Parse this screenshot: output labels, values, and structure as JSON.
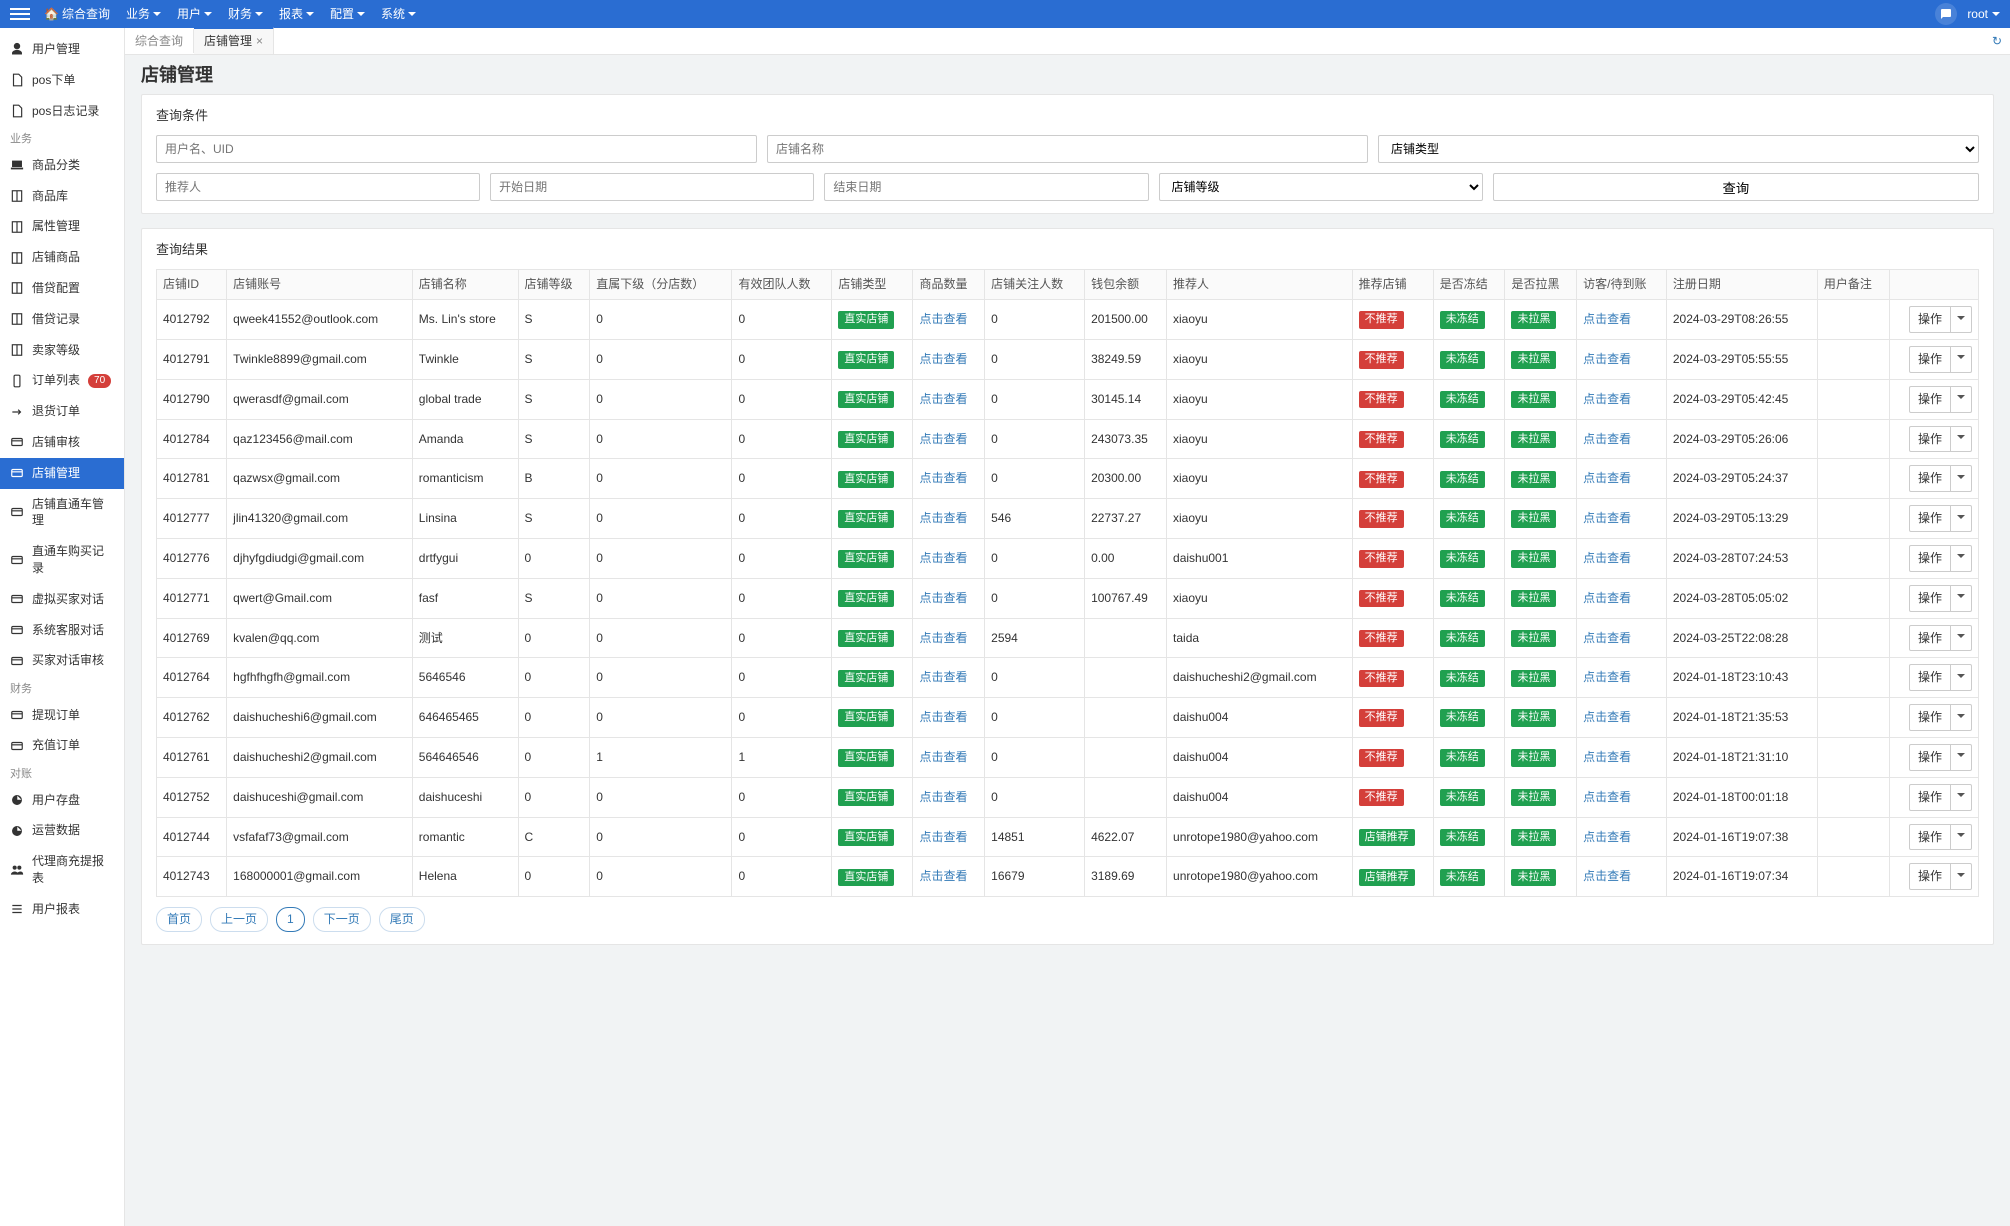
{
  "topnav": {
    "home": "综合查询",
    "items": [
      "业务",
      "用户",
      "财务",
      "报表",
      "配置",
      "系统"
    ],
    "user": "root"
  },
  "sidebar": {
    "sections": [
      {
        "group": null,
        "items": [
          {
            "icon": "user",
            "label": "用户管理"
          },
          {
            "icon": "doc",
            "label": "pos下单"
          },
          {
            "icon": "doc",
            "label": "pos日志记录"
          }
        ]
      },
      {
        "group": "业务",
        "items": [
          {
            "icon": "laptop",
            "label": "商品分类"
          },
          {
            "icon": "book",
            "label": "商品库"
          },
          {
            "icon": "book",
            "label": "属性管理"
          },
          {
            "icon": "book",
            "label": "店铺商品"
          },
          {
            "icon": "book",
            "label": "借贷配置"
          },
          {
            "icon": "book",
            "label": "借贷记录"
          },
          {
            "icon": "book",
            "label": "卖家等级"
          },
          {
            "icon": "phone",
            "label": "订单列表",
            "badge": "70"
          },
          {
            "icon": "arrow",
            "label": "退货订单"
          },
          {
            "icon": "card",
            "label": "店铺审核"
          },
          {
            "icon": "card",
            "label": "店铺管理",
            "active": true
          },
          {
            "icon": "card",
            "label": "店铺直通车管理"
          },
          {
            "icon": "card",
            "label": "直通车购买记录"
          },
          {
            "icon": "card",
            "label": "虚拟买家对话"
          },
          {
            "icon": "card",
            "label": "系统客服对话"
          },
          {
            "icon": "card",
            "label": "买家对话审核"
          }
        ]
      },
      {
        "group": "财务",
        "items": [
          {
            "icon": "card",
            "label": "提现订单"
          },
          {
            "icon": "card",
            "label": "充值订单"
          }
        ]
      },
      {
        "group": "对账",
        "items": [
          {
            "icon": "pie",
            "label": "用户存盘"
          },
          {
            "icon": "pie",
            "label": "运营数据"
          },
          {
            "icon": "people",
            "label": "代理商充提报表"
          },
          {
            "icon": "list",
            "label": "用户报表"
          }
        ]
      }
    ]
  },
  "tabs": {
    "inactive": "综合查询",
    "active": "店铺管理"
  },
  "page": {
    "title": "店铺管理"
  },
  "filters": {
    "title": "查询条件",
    "user_placeholder": "用户名、UID",
    "store_name_placeholder": "店铺名称",
    "store_type_placeholder": "店铺类型",
    "referrer_placeholder": "推荐人",
    "start_date_placeholder": "开始日期",
    "end_date_placeholder": "结束日期",
    "store_level_placeholder": "店铺等级",
    "query_btn": "查询"
  },
  "results": {
    "title": "查询结果",
    "headers": [
      "店铺ID",
      "店铺账号",
      "店铺名称",
      "店铺等级",
      "直属下级（分店数）",
      "有效团队人数",
      "店铺类型",
      "商品数量",
      "店铺关注人数",
      "钱包余额",
      "推荐人",
      "推荐店铺",
      "是否冻结",
      "是否拉黑",
      "访客/待到账",
      "注册日期",
      "用户备注",
      ""
    ],
    "type_label": "直实店铺",
    "click_view": "点击查看",
    "not_recommend": "不推荐",
    "recommend_label": "店铺推荐",
    "unfrozen": "未冻结",
    "unblack": "未拉黑",
    "op": "操作",
    "rows": [
      {
        "id": "4012792",
        "acct": "qweek41552@outlook.com",
        "name": "Ms. Lin's store",
        "level": "S",
        "sub": "0",
        "team": "0",
        "qty": "",
        "follow": "0",
        "wallet": "201500.00",
        "ref": "xiaoyu",
        "rec": "not",
        "date": "2024-03-29T08:26:55",
        "remark": ""
      },
      {
        "id": "4012791",
        "acct": "Twinkle8899@gmail.com",
        "name": "Twinkle",
        "level": "S",
        "sub": "0",
        "team": "0",
        "qty": "",
        "follow": "0",
        "wallet": "38249.59",
        "ref": "xiaoyu",
        "rec": "not",
        "date": "2024-03-29T05:55:55",
        "remark": ""
      },
      {
        "id": "4012790",
        "acct": "qwerasdf@gmail.com",
        "name": "global trade",
        "level": "S",
        "sub": "0",
        "team": "0",
        "qty": "",
        "follow": "0",
        "wallet": "30145.14",
        "ref": "xiaoyu",
        "rec": "not",
        "date": "2024-03-29T05:42:45",
        "remark": ""
      },
      {
        "id": "4012784",
        "acct": "qaz123456@mail.com",
        "name": "Amanda",
        "level": "S",
        "sub": "0",
        "team": "0",
        "qty": "",
        "follow": "0",
        "wallet": "243073.35",
        "ref": "xiaoyu",
        "rec": "not",
        "date": "2024-03-29T05:26:06",
        "remark": ""
      },
      {
        "id": "4012781",
        "acct": "qazwsx@gmail.com",
        "name": "romanticism",
        "level": "B",
        "sub": "0",
        "team": "0",
        "qty": "",
        "follow": "0",
        "wallet": "20300.00",
        "ref": "xiaoyu",
        "rec": "not",
        "date": "2024-03-29T05:24:37",
        "remark": ""
      },
      {
        "id": "4012777",
        "acct": "jlin41320@gmail.com",
        "name": "Linsina",
        "level": "S",
        "sub": "0",
        "team": "0",
        "qty": "",
        "follow": "546",
        "wallet": "22737.27",
        "ref": "xiaoyu",
        "rec": "not",
        "date": "2024-03-29T05:13:29",
        "remark": ""
      },
      {
        "id": "4012776",
        "acct": "djhyfgdiudgi@gmail.com",
        "name": "drtfygui",
        "level": "0",
        "sub": "0",
        "team": "0",
        "qty": "",
        "follow": "0",
        "wallet": "0.00",
        "ref": "daishu001",
        "rec": "not",
        "date": "2024-03-28T07:24:53",
        "remark": ""
      },
      {
        "id": "4012771",
        "acct": "qwert@Gmail.com",
        "name": "fasf",
        "level": "S",
        "sub": "0",
        "team": "0",
        "qty": "",
        "follow": "0",
        "wallet": "100767.49",
        "ref": "xiaoyu",
        "rec": "not",
        "date": "2024-03-28T05:05:02",
        "remark": ""
      },
      {
        "id": "4012769",
        "acct": "kvalen@qq.com",
        "name": "测试",
        "level": "0",
        "sub": "0",
        "team": "0",
        "qty": "",
        "follow": "2594",
        "wallet": "",
        "ref": "taida",
        "rec": "not",
        "date": "2024-03-25T22:08:28",
        "remark": ""
      },
      {
        "id": "4012764",
        "acct": "hgfhfhgfh@gmail.com",
        "name": "5646546",
        "level": "0",
        "sub": "0",
        "team": "0",
        "qty": "",
        "follow": "0",
        "wallet": "",
        "ref": "daishucheshi2@gmail.com",
        "rec": "not",
        "date": "2024-01-18T23:10:43",
        "remark": ""
      },
      {
        "id": "4012762",
        "acct": "daishucheshi6@gmail.com",
        "name": "646465465",
        "level": "0",
        "sub": "0",
        "team": "0",
        "qty": "",
        "follow": "0",
        "wallet": "",
        "ref": "daishu004",
        "rec": "not",
        "date": "2024-01-18T21:35:53",
        "remark": ""
      },
      {
        "id": "4012761",
        "acct": "daishucheshi2@gmail.com",
        "name": "564646546",
        "level": "0",
        "sub": "1",
        "team": "1",
        "qty": "",
        "follow": "0",
        "wallet": "",
        "ref": "daishu004",
        "rec": "not",
        "date": "2024-01-18T21:31:10",
        "remark": ""
      },
      {
        "id": "4012752",
        "acct": "daishuceshi@gmail.com",
        "name": "daishuceshi",
        "level": "0",
        "sub": "0",
        "team": "0",
        "qty": "",
        "follow": "0",
        "wallet": "",
        "ref": "daishu004",
        "rec": "not",
        "date": "2024-01-18T00:01:18",
        "remark": ""
      },
      {
        "id": "4012744",
        "acct": "vsfafaf73@gmail.com",
        "name": "romantic",
        "level": "C",
        "sub": "0",
        "team": "0",
        "qty": "",
        "follow": "14851",
        "wallet": "4622.07",
        "ref": "unrotope1980@yahoo.com",
        "rec": "yes",
        "date": "2024-01-16T19:07:38",
        "remark": ""
      },
      {
        "id": "4012743",
        "acct": "168000001@gmail.com",
        "name": "Helena",
        "level": "0",
        "sub": "0",
        "team": "0",
        "qty": "",
        "follow": "16679",
        "wallet": "3189.69",
        "ref": "unrotope1980@yahoo.com",
        "rec": "yes",
        "date": "2024-01-16T19:07:34",
        "remark": ""
      }
    ]
  },
  "pager": {
    "first": "首页",
    "prev": "上一页",
    "page": "1",
    "next": "下一页",
    "last": "尾页"
  }
}
